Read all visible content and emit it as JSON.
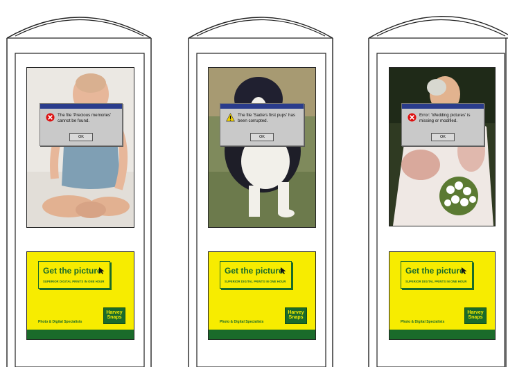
{
  "kiosks": [
    {
      "dialog_message": "The file 'Precious memories' cannot be found.",
      "dialog_icon": "error-icon",
      "ok_label": "OK"
    },
    {
      "dialog_message": "The file 'Sadie's first pups' has been corrupted.",
      "dialog_icon": "warning-icon",
      "ok_label": "OK"
    },
    {
      "dialog_message": "Error: 'Wedding pictures' is missing or modified.",
      "dialog_icon": "error-icon",
      "ok_label": "OK"
    }
  ],
  "ad": {
    "headline": "Get the picture",
    "subline": "SUPERIOR DIGITAL PRINTS IN ONE HOUR",
    "specialists": "Photo & Digital Specialists",
    "logo": "Harvey Snaps"
  },
  "colors": {
    "ad_yellow": "#f7ec00",
    "ad_green": "#1a6b2a",
    "dialog_titlebar": "#2a3c8c",
    "dialog_body": "#c9c9c9"
  }
}
